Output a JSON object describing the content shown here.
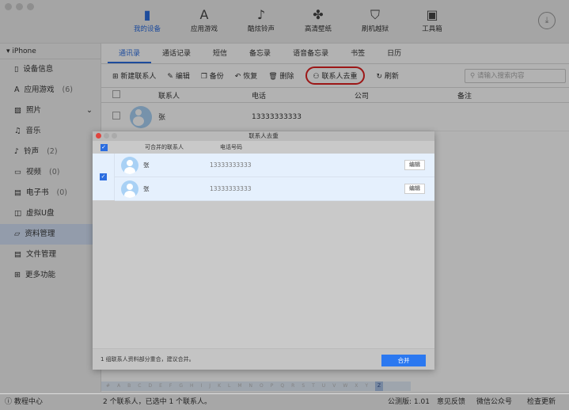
{
  "topnav": [
    {
      "label": "我的设备",
      "icon": "phone-icon"
    },
    {
      "label": "应用游戏",
      "icon": "app-store-icon"
    },
    {
      "label": "酷炫铃声",
      "icon": "music-note-icon"
    },
    {
      "label": "高清壁纸",
      "icon": "flower-icon"
    },
    {
      "label": "刷机越狱",
      "icon": "shield-icon"
    },
    {
      "label": "工具箱",
      "icon": "toolbox-icon"
    }
  ],
  "sidebar": {
    "device": "iPhone",
    "items": [
      {
        "label": "设备信息"
      },
      {
        "label": "应用游戏",
        "count": "(6)"
      },
      {
        "label": "照片"
      },
      {
        "label": "音乐"
      },
      {
        "label": "铃声",
        "count": "(2)"
      },
      {
        "label": "视频",
        "count": "(0)"
      },
      {
        "label": "电子书",
        "count": "(0)"
      },
      {
        "label": "虚拟U盘"
      },
      {
        "label": "资料管理"
      },
      {
        "label": "文件管理"
      },
      {
        "label": "更多功能"
      }
    ]
  },
  "tabs": [
    "通讯录",
    "通话记录",
    "短信",
    "备忘录",
    "语音备忘录",
    "书签",
    "日历"
  ],
  "toolbar": {
    "new": "新建联系人",
    "edit": "编辑",
    "backup": "备份",
    "restore": "恢复",
    "delete": "删除",
    "dedupe": "联系人去重",
    "refresh": "刷新",
    "search_placeholder": "请输入搜索内容"
  },
  "table": {
    "headers": [
      "联系人",
      "电话",
      "公司",
      "备注"
    ],
    "rows": [
      {
        "name": "张",
        "phone": "13333333333"
      }
    ]
  },
  "modal": {
    "title": "联系人去重",
    "headers": [
      "可合并的联系人",
      "电话号码"
    ],
    "rows": [
      {
        "name": "张",
        "phone": "13333333333",
        "edit": "编辑"
      },
      {
        "name": "张",
        "phone": "13333333333",
        "edit": "编辑"
      }
    ],
    "footer": "1 组联系人资料部分重合，建议合并。",
    "merge": "合并"
  },
  "alphabet": [
    "#",
    "A",
    "B",
    "C",
    "D",
    "E",
    "F",
    "G",
    "H",
    "I",
    "J",
    "K",
    "L",
    "M",
    "N",
    "O",
    "P",
    "Q",
    "R",
    "S",
    "T",
    "U",
    "V",
    "W",
    "X",
    "Y",
    "Z"
  ],
  "status": {
    "left_help": "教程中心",
    "summary": "2 个联系人，已选中 1 个联系人。",
    "version": "公测版: 1.01",
    "feedback": "意见反馈",
    "wechat": "微信公众号",
    "update": "检查更新"
  }
}
